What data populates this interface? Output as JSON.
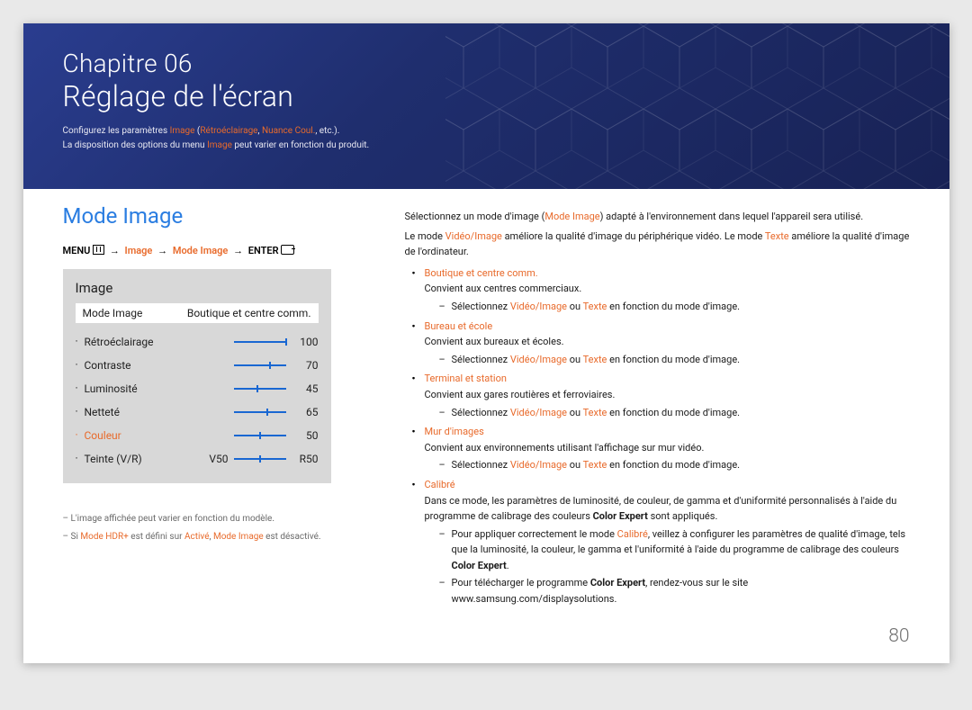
{
  "header": {
    "chapter": "Chapitre 06",
    "title": "Réglage de l'écran",
    "sub1_a": "Configurez les paramètres ",
    "sub1_b": "Image",
    "sub1_c": " (",
    "sub1_d": "Rétroéclairage",
    "sub1_e": ", ",
    "sub1_f": "Nuance Coul.",
    "sub1_g": ", etc.).",
    "sub2_a": "La disposition des options du menu ",
    "sub2_b": "Image",
    "sub2_c": " peut varier en fonction du produit."
  },
  "left": {
    "section": "Mode Image",
    "breadcrumb": {
      "menu": "MENU",
      "seg1": "Image",
      "seg2": "Mode Image",
      "enter": "ENTER"
    },
    "panel": {
      "title": "Image",
      "mode_label": "Mode Image",
      "mode_value": "Boutique et centre comm.",
      "settings": [
        {
          "label": "Rétroéclairage",
          "value": "100",
          "pct": 100,
          "color": "#222"
        },
        {
          "label": "Contraste",
          "value": "70",
          "pct": 70,
          "color": "#222"
        },
        {
          "label": "Luminosité",
          "value": "45",
          "pct": 45,
          "color": "#222"
        },
        {
          "label": "Netteté",
          "value": "65",
          "pct": 65,
          "color": "#222"
        },
        {
          "label": "Couleur",
          "value": "50",
          "pct": 50,
          "color": "#e86a2b"
        }
      ],
      "tint": {
        "label": "Teinte (V/R)",
        "left": "V50",
        "right": "R50",
        "pct": 50
      }
    },
    "notes": {
      "n1": "– L'image affichée peut varier en fonction du modèle.",
      "n2_a": "– Si ",
      "n2_b": "Mode HDR+",
      "n2_c": " est défini sur ",
      "n2_d": "Activé",
      "n2_e": ", ",
      "n2_f": "Mode Image",
      "n2_g": " est désactivé."
    }
  },
  "right": {
    "p1_a": "Sélectionnez un mode d'image (",
    "p1_b": "Mode Image",
    "p1_c": ") adapté à l'environnement dans lequel l'appareil sera utilisé.",
    "p2_a": "Le mode ",
    "p2_b": "Vidéo/Image",
    "p2_c": " améliore la qualité d'image du périphérique vidéo. Le mode ",
    "p2_d": "Texte",
    "p2_e": " améliore la qualité d'image de l'ordinateur.",
    "items": [
      {
        "head": "Boutique et centre comm.",
        "desc": "Convient aux centres commerciaux.",
        "sub": [
          {
            "a": "Sélectionnez ",
            "b": "Vidéo/Image",
            "c": " ou ",
            "d": "Texte",
            "e": " en fonction du mode d'image."
          }
        ]
      },
      {
        "head": "Bureau et école",
        "desc": "Convient aux bureaux et écoles.",
        "sub": [
          {
            "a": "Sélectionnez ",
            "b": "Vidéo/Image",
            "c": " ou ",
            "d": "Texte",
            "e": " en fonction du mode d'image."
          }
        ]
      },
      {
        "head": "Terminal et station",
        "desc": "Convient aux gares routières et ferroviaires.",
        "sub": [
          {
            "a": "Sélectionnez ",
            "b": "Vidéo/Image",
            "c": " ou ",
            "d": "Texte",
            "e": " en fonction du mode d'image."
          }
        ]
      },
      {
        "head": "Mur d'images",
        "desc": "Convient aux environnements utilisant l'affichage sur mur vidéo.",
        "sub": [
          {
            "a": "Sélectionnez ",
            "b": "Vidéo/Image",
            "c": " ou ",
            "d": "Texte",
            "e": " en fonction du mode d'image."
          }
        ]
      }
    ],
    "calibre": {
      "head": "Calibré",
      "desc_a": "Dans ce mode, les paramètres de luminosité, de couleur, de gamma et d'uniformité personnalisés à l'aide du programme de calibrage des couleurs ",
      "desc_b": "Color Expert",
      "desc_c": " sont appliqués.",
      "sub1_a": "Pour appliquer correctement le mode ",
      "sub1_b": "Calibré",
      "sub1_c": ", veillez à configurer les paramètres de qualité d'image, tels que la luminosité, la couleur, le gamma et l'uniformité à l'aide du programme de calibrage des couleurs ",
      "sub1_d": "Color Expert",
      "sub1_e": ".",
      "sub2_a": "Pour télécharger le programme ",
      "sub2_b": "Color Expert",
      "sub2_c": ", rendez-vous sur le site www.samsung.com/displaysolutions."
    }
  },
  "page_number": "80"
}
